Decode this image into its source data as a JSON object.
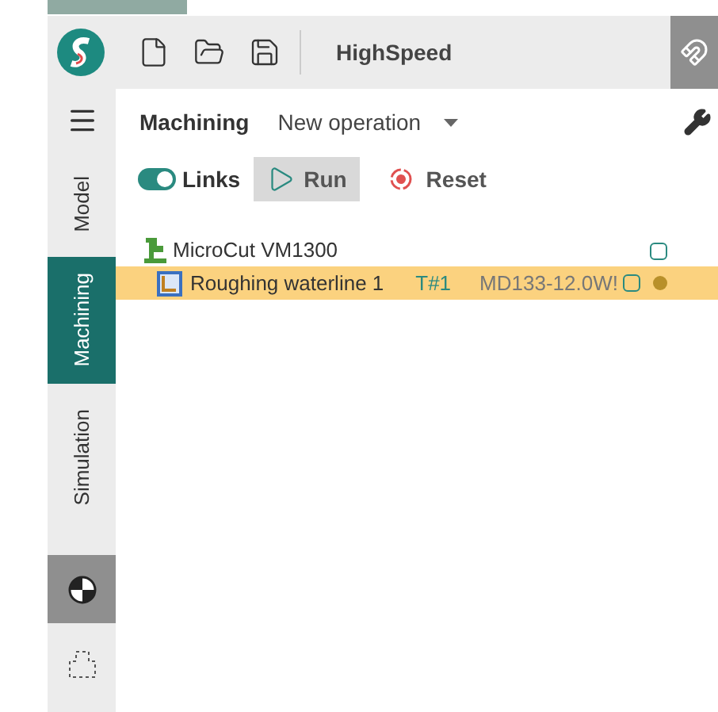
{
  "toolbar": {
    "title": "HighSpeed"
  },
  "sidebar": {
    "tabs": [
      {
        "label": "Model",
        "selected": false
      },
      {
        "label": "Machining",
        "selected": true
      },
      {
        "label": "Simulation",
        "selected": false
      }
    ]
  },
  "header": {
    "title": "Machining",
    "operation": "New operation"
  },
  "actions": {
    "links": {
      "label": "Links",
      "on": true
    },
    "run": "Run",
    "reset": "Reset"
  },
  "tree": {
    "label": "MicroCut VM1300",
    "selected": false,
    "children": [
      {
        "label": "Roughing waterline 1",
        "tool": "T#1",
        "holder": "MD133-12.0W!",
        "selected": true
      }
    ]
  }
}
